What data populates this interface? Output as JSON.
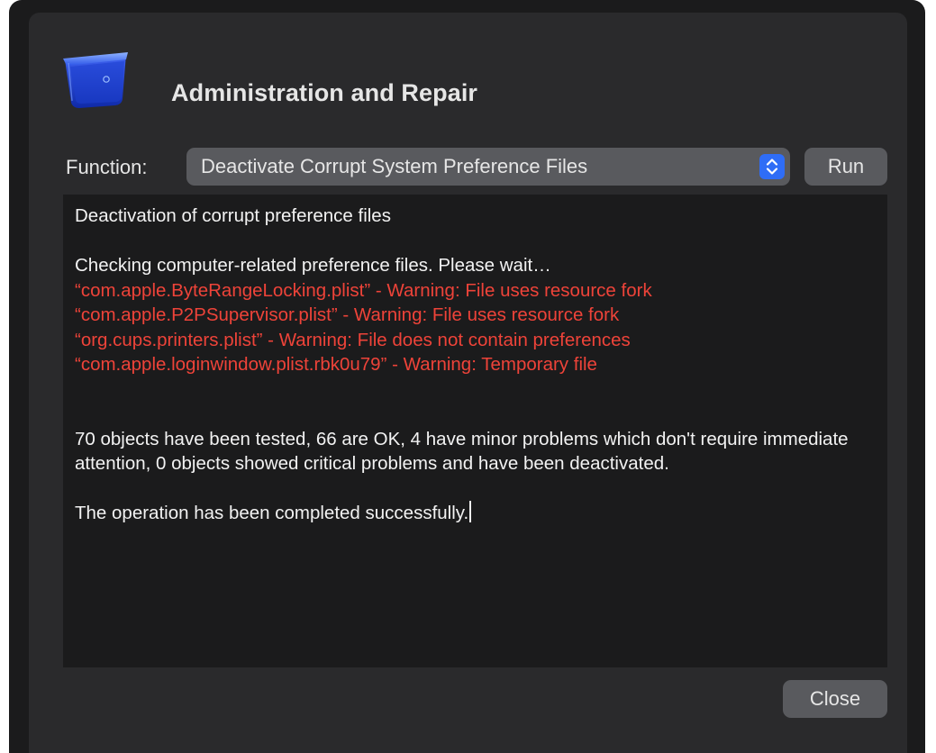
{
  "window": {
    "title": "Administration and Repair",
    "icon": "blue-bin-icon"
  },
  "function_row": {
    "label": "Function:",
    "selected_function": "Deactivate Corrupt System Preference Files",
    "stepper_icon": "up-down-chevron-icon",
    "run_label": "Run"
  },
  "log": {
    "heading": "Deactivation of corrupt preference files",
    "checking": "Checking computer-related preference files. Please wait…",
    "warnings": [
      "“com.apple.ByteRangeLocking.plist” - Warning: File uses resource fork",
      "“com.apple.P2PSupervisor.plist” - Warning: File uses resource fork",
      "“org.cups.printers.plist” - Warning: File does not contain preferences",
      "“com.apple.loginwindow.plist.rbk0u79” - Warning: Temporary file"
    ],
    "summary": "70 objects have been tested, 66 are OK, 4 have minor problems which don't require immediate attention, 0 objects showed critical problems and have been deactivated.",
    "result": "The operation has been completed successfully."
  },
  "footer": {
    "close_label": "Close"
  },
  "colors": {
    "warning": "#ee4339",
    "accent": "#2f6df6",
    "window_bg": "#2a2a2c",
    "log_bg": "#1b1b1c"
  }
}
